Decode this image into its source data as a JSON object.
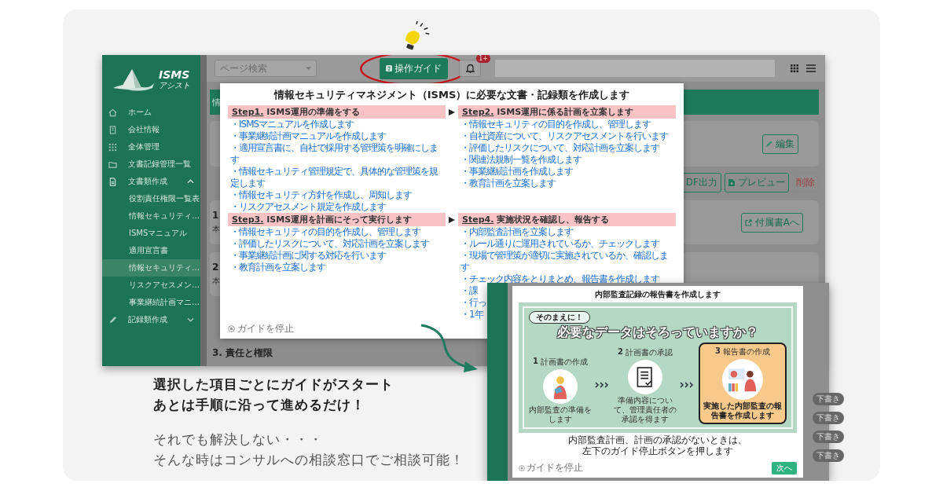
{
  "sidebar": {
    "logo_title": "ISMS",
    "logo_subtitle": "アシスト",
    "items": [
      {
        "label": "ホーム",
        "selected": false
      },
      {
        "label": "会社情報",
        "selected": false
      },
      {
        "label": "全体管理",
        "selected": false
      },
      {
        "label": "文書記録管理一覧",
        "selected": false
      },
      {
        "label": "文書類作成",
        "selected": false,
        "expanded": true,
        "children": [
          {
            "label": "役割責任権限一覧表",
            "selected": false
          },
          {
            "label": "情報セキュリティ…",
            "selected": false
          },
          {
            "label": "ISMSマニュアル",
            "selected": false
          },
          {
            "label": "適用宣言書",
            "selected": false
          },
          {
            "label": "情報セキュリティ…",
            "selected": true
          },
          {
            "label": "リスクアセスメン…",
            "selected": false
          },
          {
            "label": "事業継続計画マニ…",
            "selected": false
          }
        ]
      },
      {
        "label": "記録類作成",
        "selected": false,
        "expanded": false
      }
    ]
  },
  "topbar": {
    "search_placeholder": "ページ検索",
    "guide_button": "操作ガイド",
    "notification_count": "1+"
  },
  "content": {
    "header": "情",
    "edit_button": "編集",
    "action_buttons": [
      {
        "label": "DF出力",
        "kind": "outline"
      },
      {
        "label": "プレビュー",
        "kind": "preview"
      },
      {
        "label": "削除",
        "kind": "danger"
      }
    ],
    "annex_button": "付属書Aへ",
    "sections": [
      {
        "number": "1",
        "excerpt": "本"
      },
      {
        "number": "2",
        "excerpt": "本"
      }
    ],
    "next_section": "3. 責任と権限"
  },
  "guide": {
    "title": "情報セキュリティマネジメント（ISMS）に必要な文書・記録類を作成します",
    "steps": [
      {
        "label": "Step1.",
        "title": "ISMS運用の準備をする",
        "items": [
          "・ISMSマニュアルを作成します",
          "・事業継続計画マニュアルを作成します",
          "・適用宣言書に、自社で採用する管理策を明確にします",
          "・情報セキュリティ管理規定で、具体的な管理策を規定します",
          "・情報セキュリティ方針を作成し、周知します",
          "・リスクアセスメント規定を作成します"
        ]
      },
      {
        "label": "Step2.",
        "title": "ISMS運用に係る計画を立案します",
        "items": [
          "・情報セキュリティの目的を作成し、管理します",
          "・自社資産について、リスクアセスメントを行います",
          "・評価したリスクについて、対応計画を立案します",
          "・関連法規制一覧を作成します",
          "・事業継続計画を作成します",
          "・教育計画を立案します"
        ]
      },
      {
        "label": "Step3.",
        "title": "ISMS運用を計画にそって実行します",
        "items": [
          "・情報セキュリティの目的を作成し、管理します",
          "・評価したリスクについて、対応計画を立案します",
          "・事業継続計画に関する対応を行います",
          "・教育計画を立案します"
        ]
      },
      {
        "label": "Step4.",
        "title": "実施状況を確認し、報告する",
        "items": [
          "・内部監査計画を立案します",
          "・ルール通りに運用されているか、チェックします",
          "・現場で管理策が適切に実施されているか、確認します",
          "・チェック内容をとりまとめ、報告書を作成します",
          "・課",
          "・行っ",
          "・1年"
        ]
      }
    ],
    "stop_button": "ガイドを停止"
  },
  "audit_guide": {
    "title": "内部監査記録の報告書を作成します",
    "callout": "そのまえに！",
    "heading": "必要なデータはそろっていますか？",
    "steps": [
      {
        "number": "1",
        "label": "計画書の作成",
        "caption": "内部監査の準備をします",
        "highlighted": false
      },
      {
        "number": "2",
        "label": "計画書の承認",
        "caption": "準備内容について、管理責任者の承認を得ます",
        "highlighted": false
      },
      {
        "number": "3",
        "label": "報告書の作成",
        "caption": "実施した内部監査の報告書を作成します",
        "highlighted": true
      }
    ],
    "note_lines": [
      "内部監査計画、計画の承認がないときは、",
      "左下のガイド停止ボタンを押します"
    ],
    "stop_button": "ガイドを停止",
    "next_button": "次へ",
    "background_badges": [
      "下書き",
      "下書き",
      "下書き",
      "下書き"
    ]
  },
  "promo": {
    "lines": [
      "選択した項目ごとにガイドがスタート",
      "あとは手順に沿って進めるだけ！"
    ],
    "sub_lines": [
      "それでも解決しない・・・",
      "そんな時はコンサルへの相談窓口でご相談可能！"
    ]
  }
}
